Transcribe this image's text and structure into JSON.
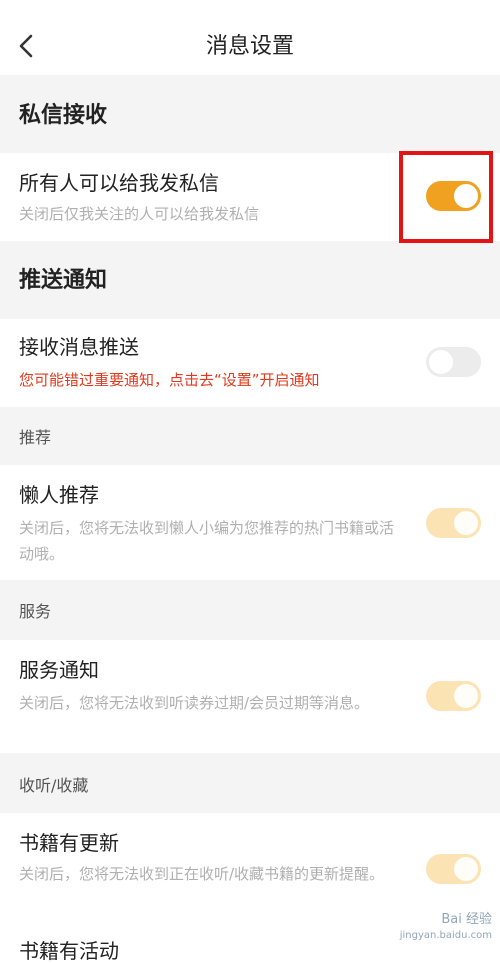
{
  "header": {
    "title": "消息设置"
  },
  "sections": {
    "private_message": "私信接收",
    "push": "推送通知",
    "recommend": "推荐",
    "service": "服务",
    "listen_collect": "收听/收藏"
  },
  "rows": [
    {
      "title": "所有人可以给我发私信",
      "desc": "关闭后仅我关注的人可以给我发私信",
      "state": "on"
    },
    {
      "title": "接收消息推送",
      "desc": "您可能错过重要通知，点击去“设置”开启通知",
      "state": "off"
    },
    {
      "title": "懒人推荐",
      "desc": "关闭后，您将无法收到懒人小编为您推荐的热门书籍或活动哦。",
      "state": "on-faded"
    },
    {
      "title": "服务通知",
      "desc": "关闭后，您将无法收到听读券过期/会员过期等消息。",
      "state": "on-faded"
    },
    {
      "title": "书籍有更新",
      "desc": "关闭后，您将无法收到正在收听/收藏书籍的更新提醒。",
      "state": "on-faded"
    },
    {
      "title": "书籍有活动"
    }
  ],
  "colors": {
    "accent": "#f0a11f",
    "warning": "#e03a1e",
    "highlight_box": "#e41414"
  },
  "watermark": {
    "line1": "Bai 经验",
    "line2": "jingyan.baidu.com"
  }
}
